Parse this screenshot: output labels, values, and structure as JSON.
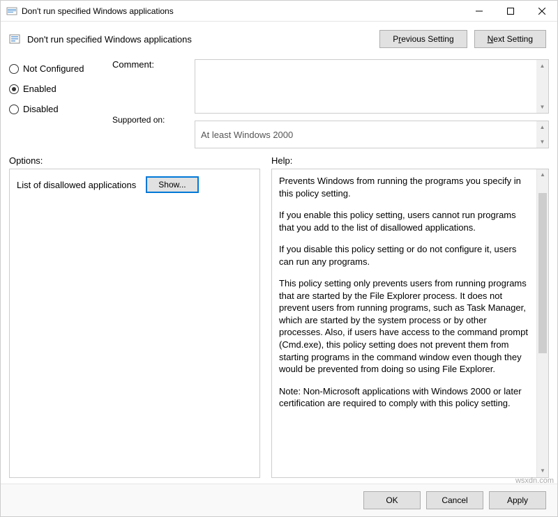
{
  "window": {
    "title": "Don't run specified Windows applications"
  },
  "header": {
    "title": "Don't run specified Windows applications",
    "prev_btn_prefix": "P",
    "prev_btn_ul": "r",
    "prev_btn_suffix": "evious Setting",
    "next_btn_ul": "N",
    "next_btn_suffix": "ext Setting"
  },
  "state": {
    "not_configured": "Not Configured",
    "enabled": "Enabled",
    "disabled": "Disabled",
    "selected": "enabled"
  },
  "labels": {
    "comment": "Comment:",
    "supported_on": "Supported on:",
    "options": "Options:",
    "help": "Help:"
  },
  "fields": {
    "comment_value": "",
    "supported_value": "At least Windows 2000"
  },
  "options": {
    "row_label": "List of disallowed applications",
    "show_btn": "Show..."
  },
  "help": {
    "p1": "Prevents Windows from running the programs you specify in this policy setting.",
    "p2": "If you enable this policy setting, users cannot run programs that you add to the list of disallowed applications.",
    "p3": "If you disable this policy setting or do not configure it, users can run any programs.",
    "p4": "This policy setting only prevents users from running programs that are started by the File Explorer process. It does not prevent users from running programs, such as Task Manager, which are started by the system process or by other processes.  Also, if users have access to the command prompt (Cmd.exe), this policy setting does not prevent them from starting programs in the command window even though they would be prevented from doing so using File Explorer.",
    "p5": "Note: Non-Microsoft applications with Windows 2000 or later certification are required to comply with this policy setting."
  },
  "footer": {
    "ok": "OK",
    "cancel": "Cancel",
    "apply": "Apply"
  },
  "watermark": "wsxdn.com"
}
